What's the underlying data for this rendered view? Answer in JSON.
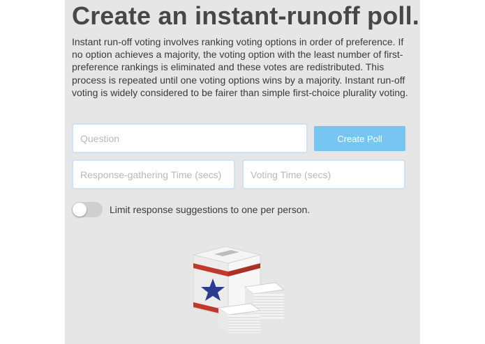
{
  "page": {
    "title": "Create an instant-runoff poll.",
    "description": "Instant run-off voting involves ranking voting options in order of preference. If no option achieves a majority, the voting option with the least number of first-preference rankings is eliminated and these votes are redistributed. This process is repeated until one voting options wins by a majority. Instant run-off voting is widely considered to be fairer than simple first-choice plurality voting."
  },
  "form": {
    "question_placeholder": "Question",
    "response_time_placeholder": "Response-gathering Time (secs)",
    "voting_time_placeholder": "Voting Time (secs)",
    "create_button_label": "Create Poll",
    "limit_toggle": {
      "label": "Limit response suggestions to one per person.",
      "checked": false
    }
  },
  "illustration": {
    "icon": "ballot-box-icon"
  },
  "colors": {
    "panel_background": "#e7e6e7",
    "button": "#77c6f2",
    "input_border": "#cfe2f2",
    "ballot_stripe": "#c0392b",
    "ballot_star": "#2c3c8f"
  }
}
